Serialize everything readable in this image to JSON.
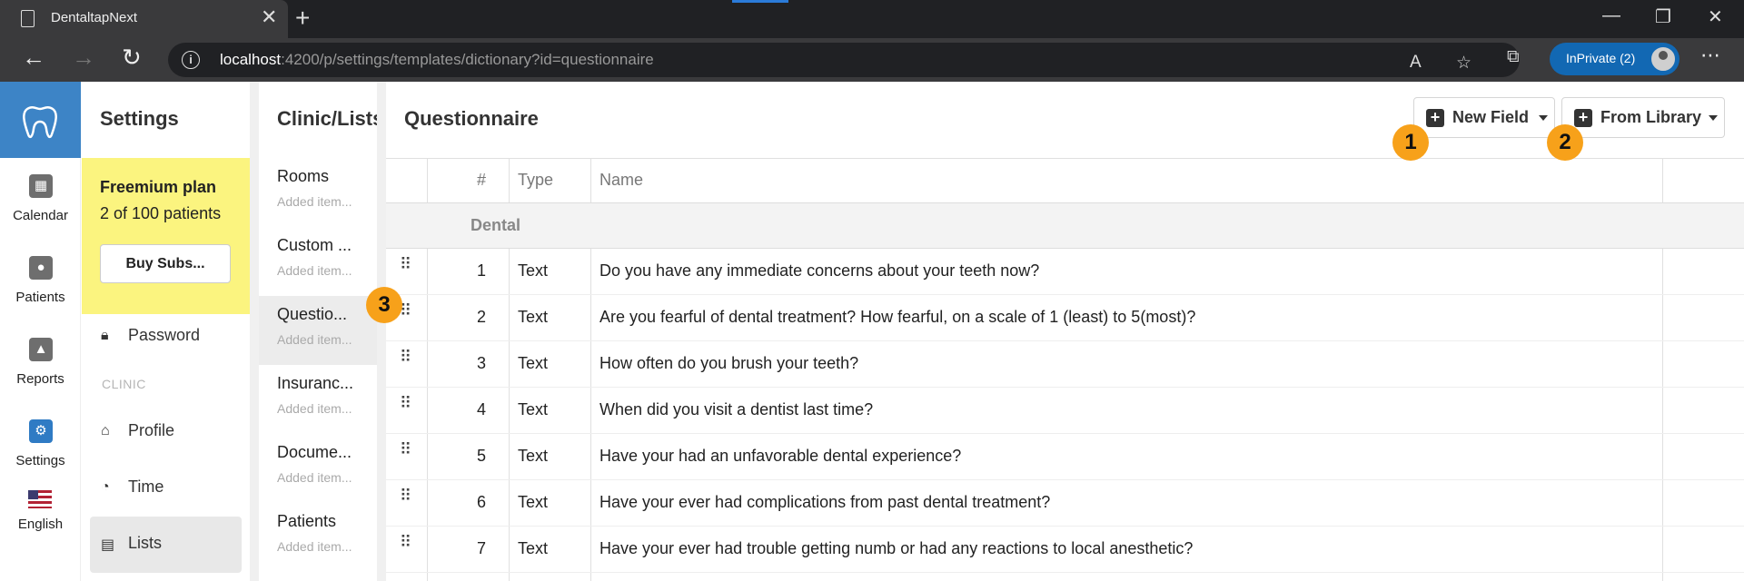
{
  "browser": {
    "tab_title": "DentaltapNext",
    "url_host": "localhost",
    "url_path": ":4200/p/settings/templates/dictionary?id=questionnaire",
    "inprivate_label": "InPrivate (2)"
  },
  "rail": {
    "items": [
      {
        "label": "Calendar",
        "icon": "calendar-icon"
      },
      {
        "label": "Patients",
        "icon": "users-icon"
      },
      {
        "label": "Reports",
        "icon": "chart-icon"
      },
      {
        "label": "Settings",
        "icon": "gear-icon"
      },
      {
        "label": "English",
        "icon": "us-flag-icon"
      }
    ]
  },
  "settings": {
    "title": "Settings",
    "plan_name": "Freemium plan",
    "plan_count": "2 of 100 patients",
    "buy_label": "Buy Subs...",
    "password_label": "Password",
    "clinic_heading": "CLINIC",
    "profile_label": "Profile",
    "time_label": "Time",
    "lists_label": "Lists"
  },
  "lists": {
    "title": "Clinic/Lists",
    "items": [
      {
        "name": "Rooms",
        "sub": "Added item..."
      },
      {
        "name": "Custom ...",
        "sub": "Added item..."
      },
      {
        "name": "Questio...",
        "sub": "Added item..."
      },
      {
        "name": "Insuranc...",
        "sub": "Added item..."
      },
      {
        "name": "Docume...",
        "sub": "Added item..."
      },
      {
        "name": "Patients",
        "sub": "Added item..."
      }
    ]
  },
  "main": {
    "title": "Questionnaire",
    "new_field_label": "New Field",
    "from_library_label": "From Library",
    "badges": [
      "1",
      "2",
      "3"
    ],
    "columns": {
      "num": "#",
      "type": "Type",
      "name": "Name"
    },
    "group": "Dental",
    "rows": [
      {
        "num": "1",
        "type": "Text",
        "name": "Do you have any immediate concerns about your teeth now?"
      },
      {
        "num": "2",
        "type": "Text",
        "name": "Are you fearful of dental treatment? How fearful, on a scale of 1 (least) to 5(most)?"
      },
      {
        "num": "3",
        "type": "Text",
        "name": "How often do you brush your teeth?"
      },
      {
        "num": "4",
        "type": "Text",
        "name": "When did you visit a dentist last time?"
      },
      {
        "num": "5",
        "type": "Text",
        "name": "Have your had an unfavorable dental experience?"
      },
      {
        "num": "6",
        "type": "Text",
        "name": "Have your ever had complications from past dental treatment?"
      },
      {
        "num": "7",
        "type": "Text",
        "name": "Have your ever had trouble getting numb or had any reactions to local anesthetic?"
      }
    ]
  }
}
